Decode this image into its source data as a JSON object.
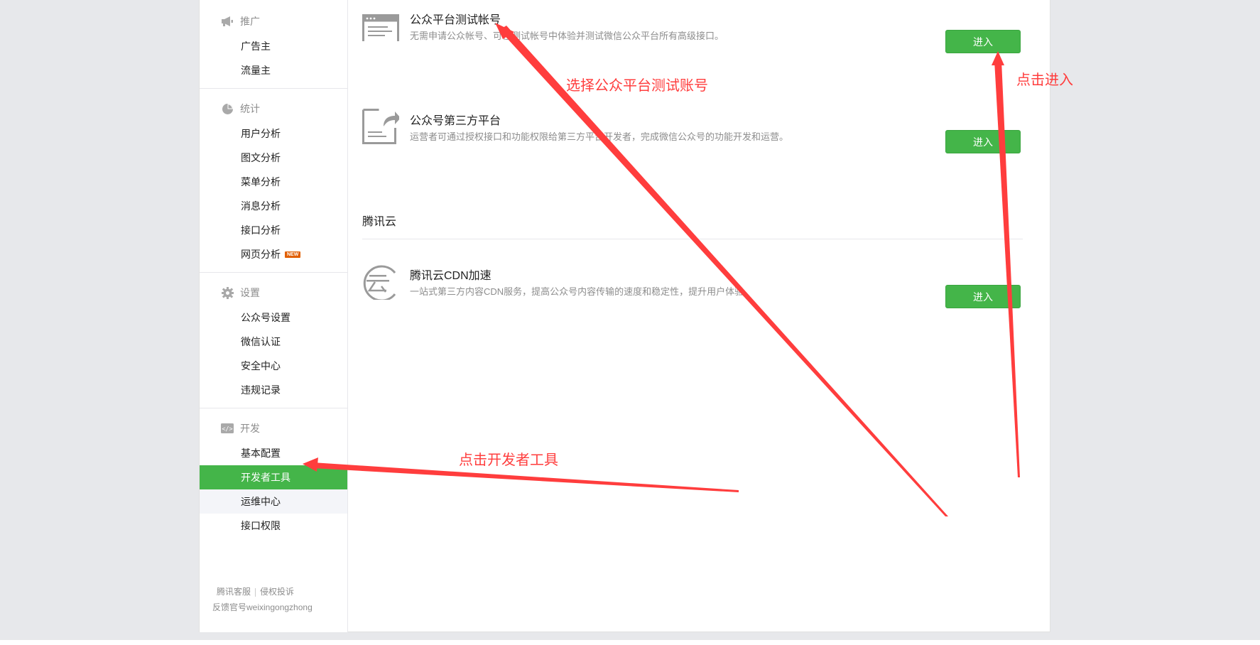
{
  "sidebar": {
    "groups": [
      {
        "title": "推广",
        "icon": "megaphone-icon",
        "items": [
          "广告主",
          "流量主"
        ]
      },
      {
        "title": "统计",
        "icon": "pie-chart-icon",
        "items": [
          "用户分析",
          "图文分析",
          "菜单分析",
          "消息分析",
          "接口分析",
          "网页分析"
        ]
      },
      {
        "title": "设置",
        "icon": "gear-icon",
        "items": [
          "公众号设置",
          "微信认证",
          "安全中心",
          "违规记录"
        ]
      },
      {
        "title": "开发",
        "icon": "code-icon",
        "items": [
          "基本配置",
          "开发者工具",
          "运维中心",
          "接口权限"
        ]
      }
    ],
    "new_badge": "NEW",
    "active_item": "开发者工具",
    "hover_item": "运维中心"
  },
  "footer": {
    "link1": "腾讯客服",
    "link2": "侵权投诉",
    "line2": "反馈官号weixingongzhong"
  },
  "entries": [
    {
      "title": "公众平台测试帐号",
      "desc": "无需申请公众帐号、可在测试帐号中体验并测试微信公众平台所有高级接口。",
      "button": "进入",
      "icon": "browser-window-icon"
    },
    {
      "title": "公众号第三方平台",
      "desc": "运营者可通过授权接口和功能权限给第三方平台开发者，完成微信公众号的功能开发和运营。",
      "button": "进入",
      "icon": "document-share-icon"
    },
    {
      "title": "腾讯云CDN加速",
      "desc": "一站式第三方内容CDN服务，提高公众号内容传输的速度和稳定性，提升用户体验。",
      "button": "进入",
      "icon": "cloud-logo-icon"
    }
  ],
  "section": {
    "title": "腾讯云"
  },
  "annotations": {
    "select_test_account": "选择公众平台测试账号",
    "click_enter": "点击进入",
    "click_dev_tools": "点击开发者工具"
  },
  "colors": {
    "accent_green": "#44b549",
    "annotation_red": "#ff3d3d",
    "badge_orange": "#e15f00"
  }
}
